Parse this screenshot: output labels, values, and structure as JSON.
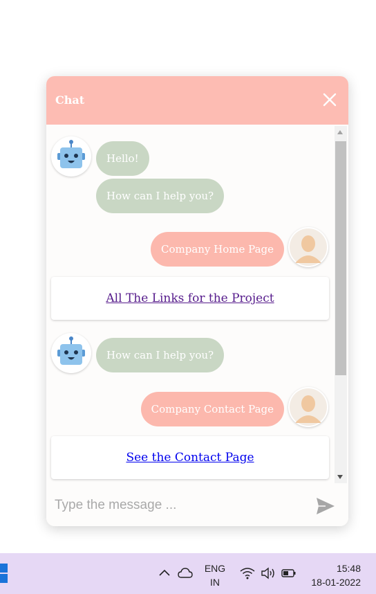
{
  "chat": {
    "title": "Chat",
    "messages": {
      "bot_greeting": "Hello!",
      "bot_help_1": "How can I help you?",
      "user_home": "Company Home Page",
      "link_project": "All The Links for the Project",
      "bot_help_2": "How can I help you?",
      "user_contact": "Company Contact Page",
      "link_contact": "See the Contact Page"
    },
    "input": {
      "placeholder": "Type the message ..."
    }
  },
  "taskbar": {
    "lang_line1": "ENG",
    "lang_line2": "IN",
    "time": "15:48",
    "date": "18-01-2022"
  },
  "colors": {
    "header": "#fdbcb3",
    "bot_bubble": "#c9d7c4",
    "user_bubble": "#fcb8ad",
    "taskbar": "#e6d8f5"
  }
}
